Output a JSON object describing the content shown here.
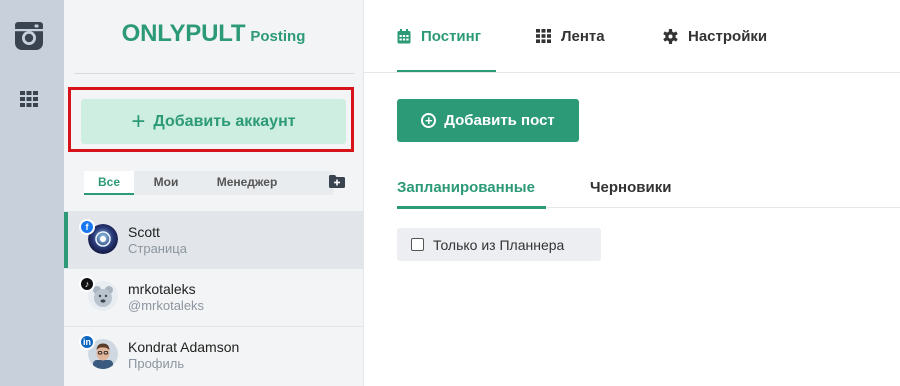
{
  "rail": {
    "app_icon": "instagram-icon",
    "grid_icon": "grid-icon"
  },
  "brand": {
    "name": "ONLYPULT",
    "product": "Posting",
    "color": "#2d9a77"
  },
  "sidebar": {
    "add_account_label": "Добавить аккаунт",
    "filters": [
      {
        "label": "Все",
        "active": true
      },
      {
        "label": "Мои",
        "active": false
      },
      {
        "label": "Менеджер",
        "active": false
      }
    ],
    "folder_icon": "folder-add-icon",
    "accounts": [
      {
        "name": "Scott",
        "subtitle": "Страница",
        "network": "facebook",
        "selected": true
      },
      {
        "name": "mrkotaleks",
        "subtitle": "@mrkotaleks",
        "network": "tiktok",
        "selected": false
      },
      {
        "name": "Kondrat Adamson",
        "subtitle": "Профиль",
        "network": "linkedin",
        "selected": false
      }
    ]
  },
  "header": {
    "tabs": [
      {
        "label": "Постинг",
        "icon": "calendar-icon",
        "active": true
      },
      {
        "label": "Лента",
        "icon": "grid-icon",
        "active": false
      },
      {
        "label": "Настройки",
        "icon": "gear-icon",
        "active": false
      }
    ]
  },
  "main": {
    "add_post_label": "Добавить пост",
    "subtabs": [
      {
        "label": "Запланированные",
        "active": true
      },
      {
        "label": "Черновики",
        "active": false
      }
    ],
    "filter_checkbox": {
      "label": "Только из Планнера",
      "checked": false
    }
  },
  "colors": {
    "accent": "#2d9a77",
    "accent_light": "#cdeee0",
    "highlight_frame": "#d6131b",
    "rail": "#c7d0db"
  }
}
